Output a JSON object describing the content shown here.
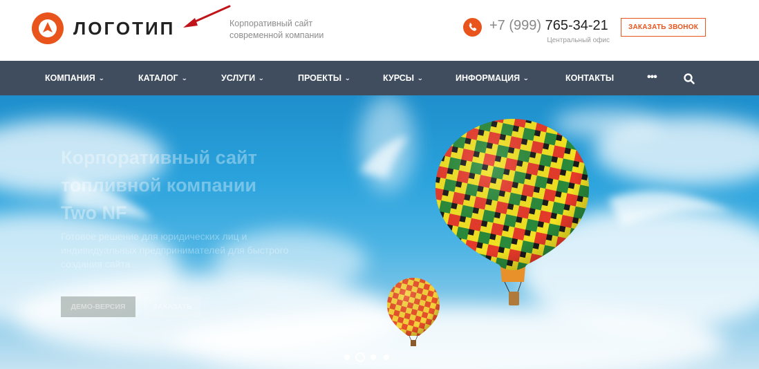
{
  "header": {
    "logo_text": "ЛОГОТИП",
    "tagline_line1": "Корпоративный сайт",
    "tagline_line2": "современной компании",
    "phone_code": "+7 (999)",
    "phone_number": "765-34-21",
    "office": "Центральный офис",
    "callback_label": "ЗАКАЗАТЬ ЗВОНОК"
  },
  "nav": {
    "items": [
      {
        "label": "КОМПАНИЯ",
        "dropdown": true
      },
      {
        "label": "КАТАЛОГ",
        "dropdown": true
      },
      {
        "label": "УСЛУГИ",
        "dropdown": true
      },
      {
        "label": "ПРОЕКТЫ",
        "dropdown": true
      },
      {
        "label": "КУРСЫ",
        "dropdown": true
      },
      {
        "label": "ИНФОРМАЦИЯ",
        "dropdown": true
      },
      {
        "label": "КОНТАКТЫ",
        "dropdown": false
      }
    ],
    "more": "•••",
    "chevron": "⌄"
  },
  "hero": {
    "title_line1": "Корпоративный сайт",
    "title_line2": "топливной компании",
    "title_line3": "Two NF",
    "subtitle_line1": "Готовое решение для юридических лиц и",
    "subtitle_line2": "индивидуальных предпринимателей для быстрого",
    "subtitle_line3": "создания сайта.",
    "demo_label": "ДЕМО-ВЕРСИЯ",
    "order_label": "ЗАКАЗАТЬ"
  },
  "slider": {
    "count": 4,
    "active_index": 1
  },
  "colors": {
    "accent": "#e8541b",
    "nav_bg": "#3f4d5f",
    "annotation_arrow": "#c0141b"
  },
  "icons": {
    "logo": "logo-mark-icon",
    "phone": "phone-icon",
    "search": "search-icon",
    "more": "more-dots-icon",
    "arrow": "annotation-arrow-icon"
  }
}
